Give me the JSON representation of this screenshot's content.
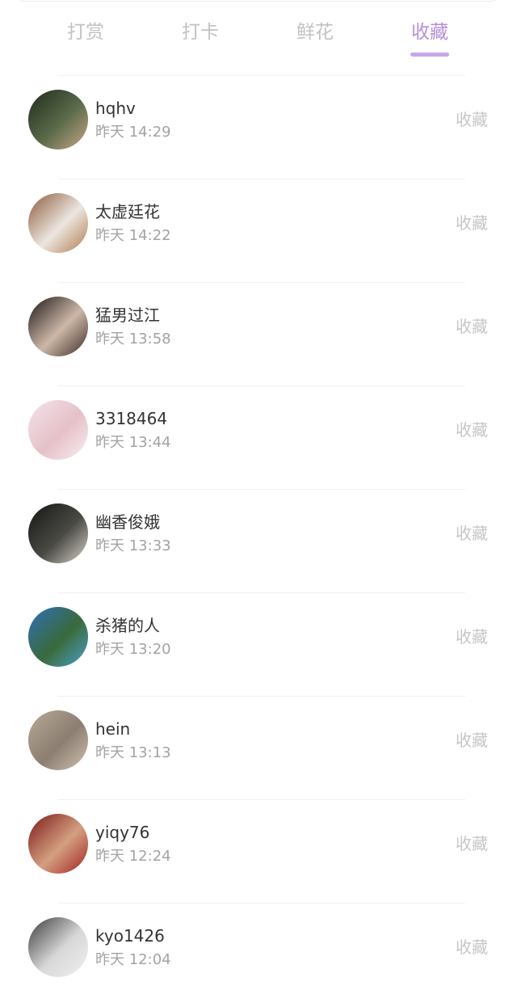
{
  "tabs": [
    {
      "label": "打赏",
      "active": false
    },
    {
      "label": "打卡",
      "active": false
    },
    {
      "label": "鲜花",
      "active": false
    },
    {
      "label": "收藏",
      "active": true
    }
  ],
  "colors": {
    "accent": "#b58fd8",
    "tab_inactive": "#c2c2c2",
    "name_text": "#333333",
    "time_text": "#a3a3a3",
    "action_text": "#c6c6c6"
  },
  "items": [
    {
      "name": "hqhv",
      "time": "昨天 14:29",
      "action": "收藏",
      "avatar_colors": [
        "#1f2a1c",
        "#5b6b4a",
        "#c9a88a"
      ]
    },
    {
      "name": "太虚廷花",
      "time": "昨天 14:22",
      "action": "收藏",
      "avatar_colors": [
        "#8a5a3a",
        "#ece6e0",
        "#b07a4e"
      ]
    },
    {
      "name": "猛男过江",
      "time": "昨天 13:58",
      "action": "收藏",
      "avatar_colors": [
        "#1a1414",
        "#cdb8a8",
        "#3a2a24"
      ]
    },
    {
      "name": "3318464",
      "time": "昨天 13:44",
      "action": "收藏",
      "avatar_colors": [
        "#f3e4ea",
        "#e6c0c8",
        "#f8f0f2"
      ]
    },
    {
      "name": "幽香俊娥",
      "time": "昨天 13:33",
      "action": "收藏",
      "avatar_colors": [
        "#141414",
        "#4a4a44",
        "#d8d4cc"
      ]
    },
    {
      "name": "杀猪的人",
      "time": "昨天 13:20",
      "action": "收藏",
      "avatar_colors": [
        "#2f6fb8",
        "#3a6a3a",
        "#4aa0c8"
      ]
    },
    {
      "name": "hein",
      "time": "昨天 13:13",
      "action": "收藏",
      "avatar_colors": [
        "#b8aa98",
        "#8c7e70",
        "#cfc3b3"
      ]
    },
    {
      "name": "yiqy76",
      "time": "昨天 12:24",
      "action": "收藏",
      "avatar_colors": [
        "#7a1616",
        "#d4a080",
        "#a02020"
      ]
    },
    {
      "name": "kyo1426",
      "time": "昨天 12:04",
      "action": "收藏",
      "avatar_colors": [
        "#3a3a3a",
        "#d8d8d8",
        "#f0f0f0"
      ]
    }
  ]
}
